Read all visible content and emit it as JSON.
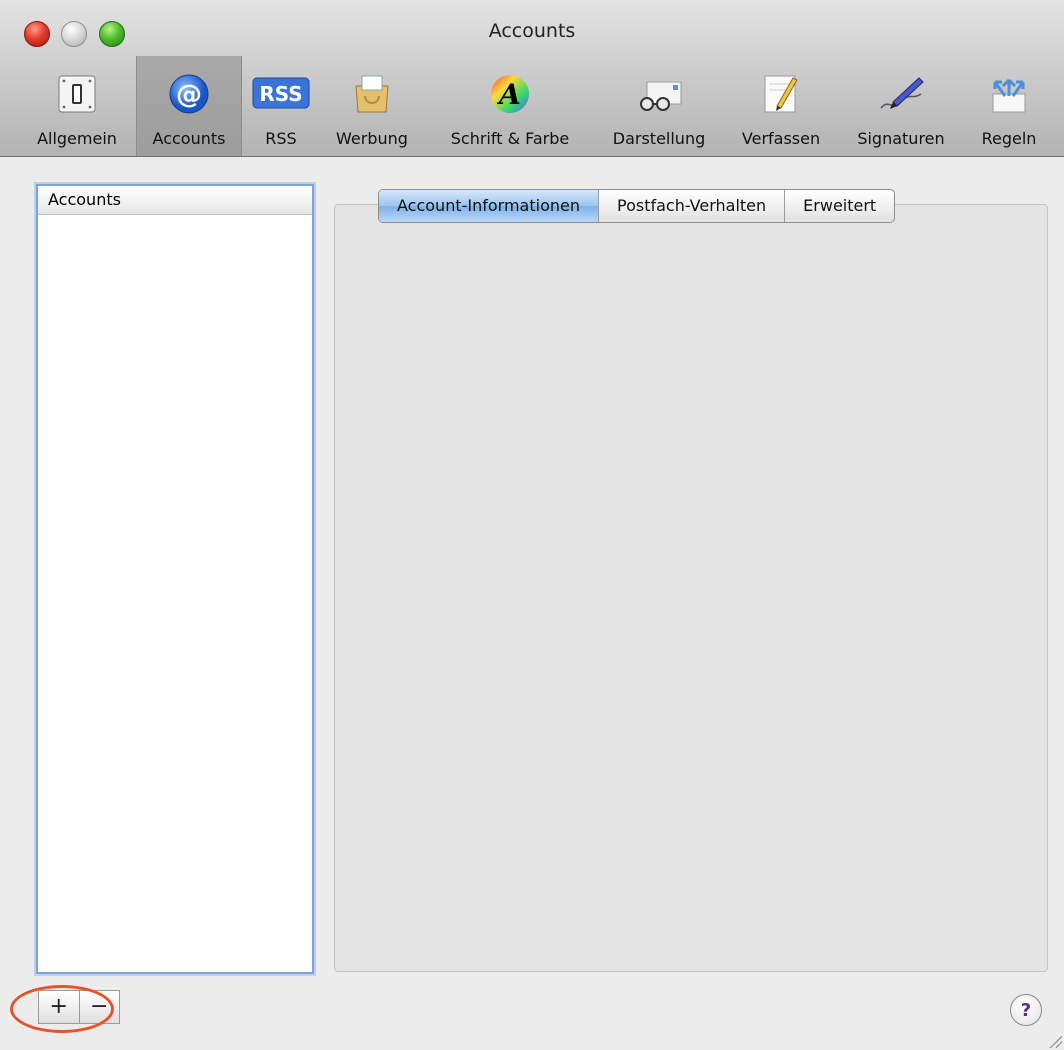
{
  "window": {
    "title": "Accounts"
  },
  "toolbar": {
    "items": [
      {
        "label": "Allgemein",
        "icon": "switch-icon"
      },
      {
        "label": "Accounts",
        "icon": "at-icon",
        "selected": true
      },
      {
        "label": "RSS",
        "icon": "rss-icon"
      },
      {
        "label": "Werbung",
        "icon": "junk-mail-icon"
      },
      {
        "label": "Schrift & Farbe",
        "icon": "font-color-icon"
      },
      {
        "label": "Darstellung",
        "icon": "glasses-icon"
      },
      {
        "label": "Verfassen",
        "icon": "compose-pencil-icon"
      },
      {
        "label": "Signaturen",
        "icon": "pen-signature-icon"
      },
      {
        "label": "Regeln",
        "icon": "rules-arrows-icon"
      }
    ],
    "rss_badge": "RSS",
    "font_letter": "A",
    "at_symbol": "@"
  },
  "accounts_list": {
    "header": "Accounts",
    "items": []
  },
  "tabs": {
    "items": [
      {
        "label": "Account-Informationen",
        "active": true
      },
      {
        "label": "Postfach-Verhalten"
      },
      {
        "label": "Erweitert"
      }
    ]
  },
  "buttons": {
    "add": "+",
    "remove": "−",
    "help": "?"
  },
  "colors": {
    "selection_blue": "#7ca5d6",
    "annotation_oval": "#e4542a"
  }
}
